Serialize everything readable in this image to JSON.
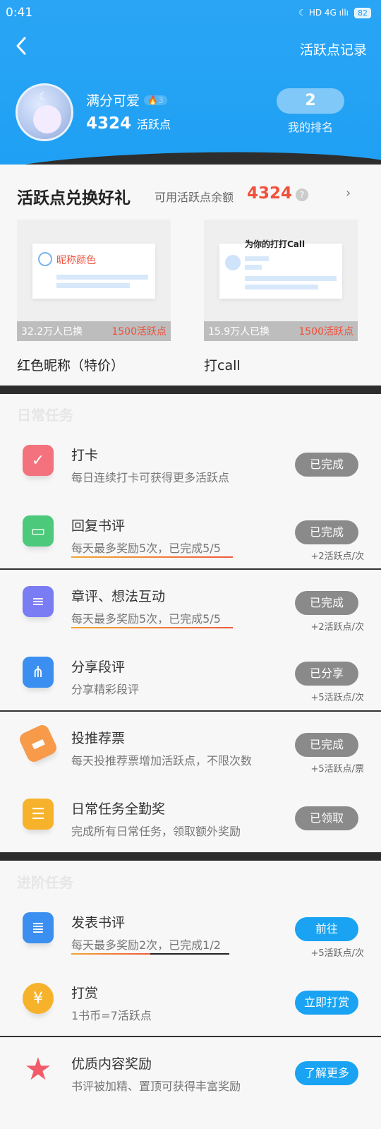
{
  "status_bar": {
    "time": "0:41",
    "icons": "☾ HD 4G ıllı",
    "battery": "82"
  },
  "header": {
    "back_icon": "chevron-left-icon",
    "record_link": "活跃点记录",
    "username": "满分可爱",
    "level": "3",
    "points": "4324",
    "points_unit": "活跃点",
    "rank": "2",
    "rank_label": "我的排名"
  },
  "exchange": {
    "title": "活跃点兑换好礼",
    "balance_label": "可用活跃点余额",
    "balance": "4324",
    "help": "?",
    "chevron": "›",
    "items": [
      {
        "name": "红色昵称（特价）",
        "preview_label": "昵称颜色",
        "count": "32.2万人已换",
        "cost": "1500活跃点"
      },
      {
        "name": "打call",
        "preview_label": "为你的打打Call",
        "count": "15.9万人已换",
        "cost": "1500活跃点"
      }
    ]
  },
  "daily": {
    "section_title": "日常任务",
    "tasks": [
      {
        "title": "打卡",
        "desc": "每日连续打卡可获得更多活跃点",
        "button": "已完成",
        "reward": "",
        "icon": "calendar-check-icon",
        "color": "#f4727e"
      },
      {
        "title": "回复书评",
        "desc": "每天最多奖励5次，已完成5/5",
        "button": "已完成",
        "reward": "+2活跃点/次",
        "icon": "chat-bubbles-icon",
        "color": "#4cc97a"
      },
      {
        "title": "章评、想法互动",
        "desc": "每天最多奖励5次，已完成5/5",
        "button": "已完成",
        "reward": "+2活跃点/次",
        "icon": "note-cards-icon",
        "color": "#7a7cf3"
      },
      {
        "title": "分享段评",
        "desc": "分享精彩段评",
        "button": "已分享",
        "reward": "+5活跃点/次",
        "icon": "share-icon",
        "color": "#3b8ff0"
      },
      {
        "title": "投推荐票",
        "desc": "每天投推荐票增加活跃点，不限次数",
        "button": "已完成",
        "reward": "+5活跃点/票",
        "icon": "ticket-icon",
        "color": "#f79a4a"
      },
      {
        "title": "日常任务全勤奖",
        "desc": "完成所有日常任务，领取额外奖励",
        "button": "已领取",
        "reward": "",
        "icon": "list-icon",
        "color": "#f7b22c"
      }
    ]
  },
  "advanced": {
    "section_title": "进阶任务",
    "tasks": [
      {
        "title": "发表书评",
        "desc": "每天最多奖励2次，已完成1/2",
        "button": "前往",
        "reward": "+5活跃点/次",
        "icon": "document-icon",
        "color": "#3b8ff0"
      },
      {
        "title": "打赏",
        "desc": "1书币=7活跃点",
        "button": "立即打赏",
        "reward": "",
        "icon": "money-bag-icon",
        "color": "#f7b22c"
      },
      {
        "title": "优质内容奖励",
        "desc": "书评被加精、置顶可获得丰富奖励",
        "button": "了解更多",
        "reward": "",
        "icon": "star-icon",
        "color": "#f25c6a"
      }
    ]
  }
}
